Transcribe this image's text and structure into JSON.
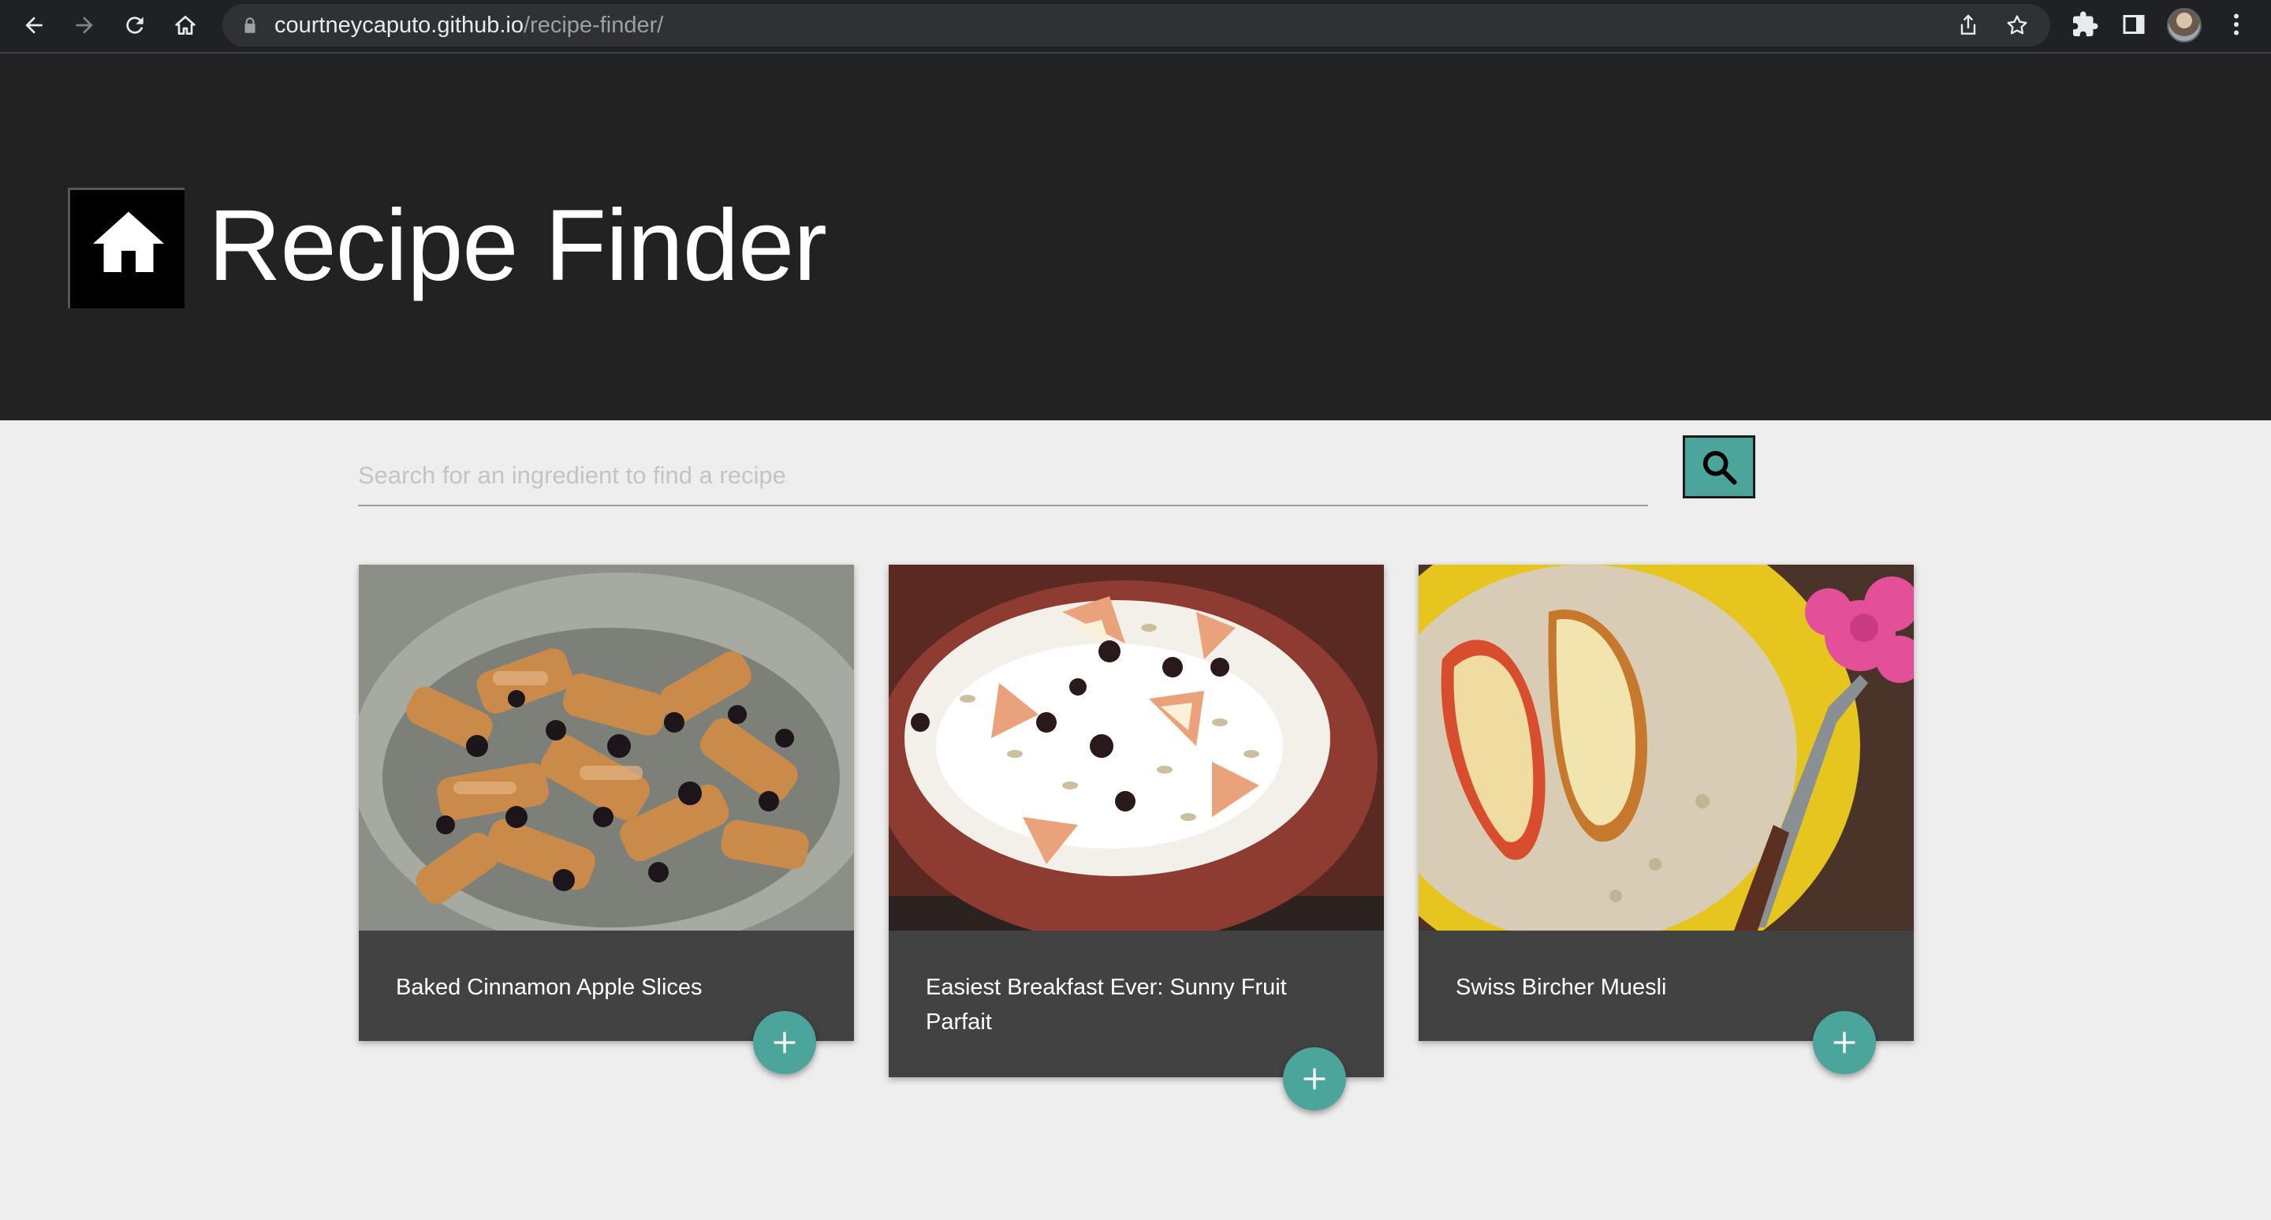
{
  "browser": {
    "url_host": "courtneycaputo.github.io",
    "url_path": "/recipe-finder/",
    "icons": [
      "back-icon",
      "forward-icon",
      "reload-icon",
      "home-icon",
      "lock-icon",
      "share-icon",
      "bookmark-star-icon",
      "extensions-icon",
      "side-panel-icon",
      "profile-avatar",
      "menu-icon"
    ]
  },
  "header": {
    "title": "Recipe Finder",
    "logo_icon": "house-icon"
  },
  "search": {
    "placeholder": "Search for an ingredient to find a recipe",
    "value": "",
    "button_icon": "search-icon"
  },
  "recipes": [
    {
      "title": "Baked Cinnamon Apple Slices",
      "image": "baked cinnamon apple slices with raisins on a grey plate"
    },
    {
      "title": "Easiest Breakfast Ever: Sunny Fruit Parfait",
      "image": "yogurt with apple pieces, raisins and sunflower seeds in a red bowl"
    },
    {
      "title": "Swiss Bircher Muesli",
      "image": "muesli with apple slices in a yellow bowl with a fork and pink flower"
    }
  ],
  "colors": {
    "chrome": "#202124",
    "header": "#222222",
    "page_bg": "#eeeeee",
    "accent": "#4ba59b",
    "card": "#424242"
  }
}
